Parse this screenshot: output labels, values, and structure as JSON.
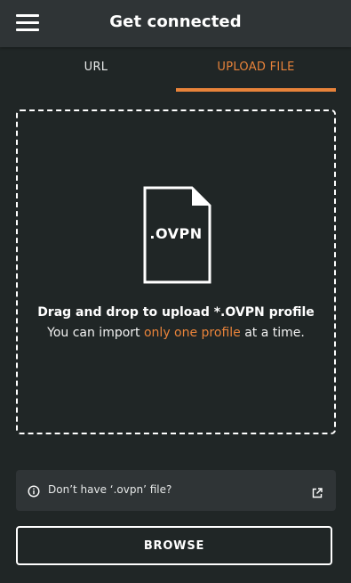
{
  "header": {
    "title": "Get connected",
    "menu_icon": "hamburger-menu-icon"
  },
  "tabs": [
    {
      "label": "URL",
      "active": false
    },
    {
      "label": "UPLOAD FILE",
      "active": true
    }
  ],
  "dropzone": {
    "file_icon": "file-icon",
    "file_extension": ".OVPN",
    "title": "Drag and drop to upload *.OVPN profile",
    "subtitle_prefix": "You can import ",
    "subtitle_highlight": "only one profile",
    "subtitle_suffix": " at a time."
  },
  "info": {
    "icon": "info-icon",
    "text": "Don’t have ‘.ovpn’ file?",
    "link_icon": "external-link-icon"
  },
  "browse_button": {
    "label": "BROWSE"
  },
  "colors": {
    "accent": "#e8833a",
    "background": "#202626",
    "header_background": "#2f3436",
    "text": "#ffffff"
  }
}
